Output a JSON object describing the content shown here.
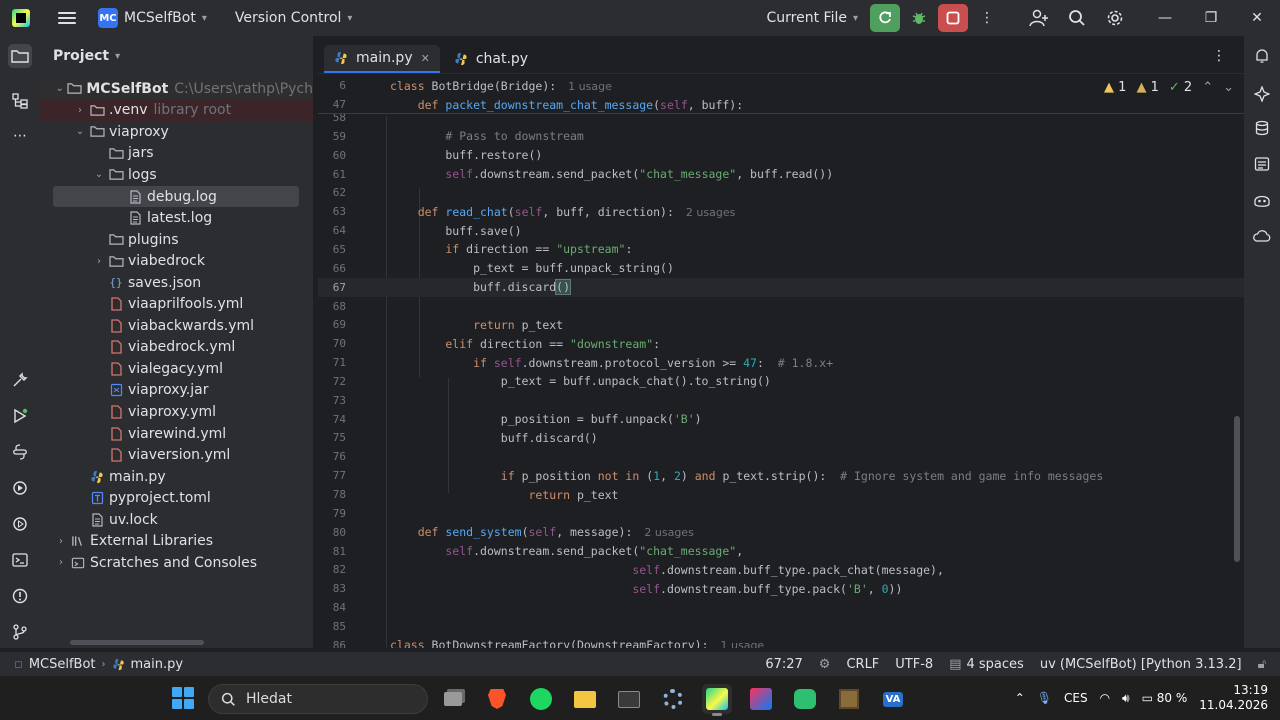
{
  "titlebar": {
    "project_badge": "MC",
    "project_name": "MCSelfBot",
    "vcs_label": "Version Control",
    "run_config": "Current File",
    "colors": {
      "run": "#4f9f5e",
      "stop": "#c94f4f"
    }
  },
  "project_panel": {
    "title": "Project",
    "tree": [
      {
        "label": "MCSelfBot",
        "hint": "C:\\Users\\rathp\\Pych",
        "icon": "folder-icon",
        "depth": 0,
        "arrow": "down",
        "bold": true
      },
      {
        "label": ".venv",
        "hint": "library root",
        "icon": "folder-icon",
        "depth": 1,
        "arrow": "right"
      },
      {
        "label": "viaproxy",
        "hint": "",
        "icon": "folder-icon",
        "depth": 1,
        "arrow": "down"
      },
      {
        "label": "jars",
        "hint": "",
        "icon": "folder-icon",
        "depth": 2,
        "arrow": ""
      },
      {
        "label": "logs",
        "hint": "",
        "icon": "folder-icon",
        "depth": 2,
        "arrow": "down"
      },
      {
        "label": "debug.log",
        "hint": "",
        "icon": "text-file-icon",
        "depth": 3,
        "arrow": "",
        "selected": true
      },
      {
        "label": "latest.log",
        "hint": "",
        "icon": "text-file-icon",
        "depth": 3,
        "arrow": ""
      },
      {
        "label": "plugins",
        "hint": "",
        "icon": "folder-icon",
        "depth": 2,
        "arrow": ""
      },
      {
        "label": "viabedrock",
        "hint": "",
        "icon": "folder-icon",
        "depth": 2,
        "arrow": "right"
      },
      {
        "label": "saves.json",
        "hint": "",
        "icon": "json-file-icon",
        "depth": 2,
        "arrow": ""
      },
      {
        "label": "viaaprilfools.yml",
        "hint": "",
        "icon": "yaml-file-icon",
        "depth": 2,
        "arrow": ""
      },
      {
        "label": "viabackwards.yml",
        "hint": "",
        "icon": "yaml-file-icon",
        "depth": 2,
        "arrow": ""
      },
      {
        "label": "viabedrock.yml",
        "hint": "",
        "icon": "yaml-file-icon",
        "depth": 2,
        "arrow": ""
      },
      {
        "label": "vialegacy.yml",
        "hint": "",
        "icon": "yaml-file-icon",
        "depth": 2,
        "arrow": ""
      },
      {
        "label": "viaproxy.jar",
        "hint": "",
        "icon": "jar-file-icon",
        "depth": 2,
        "arrow": ""
      },
      {
        "label": "viaproxy.yml",
        "hint": "",
        "icon": "yaml-file-icon",
        "depth": 2,
        "arrow": ""
      },
      {
        "label": "viarewind.yml",
        "hint": "",
        "icon": "yaml-file-icon",
        "depth": 2,
        "arrow": ""
      },
      {
        "label": "viaversion.yml",
        "hint": "",
        "icon": "yaml-file-icon",
        "depth": 2,
        "arrow": ""
      },
      {
        "label": "main.py",
        "hint": "",
        "icon": "python-file-icon",
        "depth": 1,
        "arrow": ""
      },
      {
        "label": "pyproject.toml",
        "hint": "",
        "icon": "toml-file-icon",
        "depth": 1,
        "arrow": ""
      },
      {
        "label": "uv.lock",
        "hint": "",
        "icon": "text-file-icon",
        "depth": 1,
        "arrow": ""
      },
      {
        "label": "External Libraries",
        "hint": "",
        "icon": "library-icon",
        "depth": 0,
        "arrow": "right"
      },
      {
        "label": "Scratches and Consoles",
        "hint": "",
        "icon": "scratches-icon",
        "depth": 0,
        "arrow": "right"
      }
    ]
  },
  "editor": {
    "tabs": [
      {
        "label": "main.py",
        "active": true
      },
      {
        "label": "chat.py",
        "active": false
      }
    ],
    "inspections": {
      "warnings": "1",
      "weak_warnings": "1",
      "typos": "2"
    },
    "sticky_lines": [
      {
        "num": "6",
        "tokens": [
          [
            "kw",
            "class "
          ],
          [
            "",
            "BotBridge(Bridge):"
          ]
        ],
        "usage": "1 usage"
      },
      {
        "num": "47",
        "tokens": [
          [
            "kw",
            "    def "
          ],
          [
            "fn",
            "packet_downstream_chat_message"
          ],
          [
            "",
            "("
          ],
          [
            "slf",
            "self"
          ],
          [
            "",
            ", buff):"
          ]
        ],
        "usage": ""
      }
    ],
    "lines": [
      {
        "num": "58",
        "tokens": []
      },
      {
        "num": "59",
        "tokens": [
          [
            "cmt",
            "        # Pass to downstream"
          ]
        ]
      },
      {
        "num": "60",
        "tokens": [
          [
            "",
            "        buff.restore()"
          ]
        ]
      },
      {
        "num": "61",
        "tokens": [
          [
            "slf",
            "        self"
          ],
          [
            "",
            ".downstream.send_packet("
          ],
          [
            "str",
            "\"chat_message\""
          ],
          [
            "",
            ", buff.read())"
          ]
        ]
      },
      {
        "num": "62",
        "tokens": []
      },
      {
        "num": "63",
        "tokens": [
          [
            "kw",
            "    def "
          ],
          [
            "fn",
            "read_chat"
          ],
          [
            "",
            "("
          ],
          [
            "slf",
            "self"
          ],
          [
            "",
            ", buff, direction):"
          ]
        ],
        "usage": "2 usages"
      },
      {
        "num": "64",
        "tokens": [
          [
            "",
            "        buff.save()"
          ]
        ]
      },
      {
        "num": "65",
        "tokens": [
          [
            "kw",
            "        if "
          ],
          [
            "",
            "direction == "
          ],
          [
            "str",
            "\"upstream\""
          ],
          [
            "",
            ":"
          ]
        ]
      },
      {
        "num": "66",
        "tokens": [
          [
            "",
            "            p_text = buff.unpack_string()"
          ]
        ]
      },
      {
        "num": "67",
        "tokens": [
          [
            "",
            "            buff.discard"
          ],
          [
            "brace",
            "()"
          ]
        ],
        "current": true
      },
      {
        "num": "68",
        "tokens": []
      },
      {
        "num": "69",
        "tokens": [
          [
            "kw",
            "            return "
          ],
          [
            "",
            "p_text"
          ]
        ]
      },
      {
        "num": "70",
        "tokens": [
          [
            "kw",
            "        elif "
          ],
          [
            "",
            "direction == "
          ],
          [
            "str",
            "\"downstream\""
          ],
          [
            "",
            ":"
          ]
        ]
      },
      {
        "num": "71",
        "tokens": [
          [
            "kw",
            "            if "
          ],
          [
            "slf",
            "self"
          ],
          [
            "",
            ".downstream.protocol_version >= "
          ],
          [
            "num",
            "47"
          ],
          [
            "",
            ":  "
          ],
          [
            "cmt",
            "# 1.8.x+"
          ]
        ]
      },
      {
        "num": "72",
        "tokens": [
          [
            "",
            "                p_text = buff.unpack_chat().to_string()"
          ]
        ]
      },
      {
        "num": "73",
        "tokens": []
      },
      {
        "num": "74",
        "tokens": [
          [
            "",
            "                p_position = buff.unpack("
          ],
          [
            "str",
            "'B'"
          ],
          [
            "",
            ")"
          ]
        ]
      },
      {
        "num": "75",
        "tokens": [
          [
            "",
            "                buff.discard()"
          ]
        ]
      },
      {
        "num": "76",
        "tokens": []
      },
      {
        "num": "77",
        "tokens": [
          [
            "kw",
            "                if "
          ],
          [
            "",
            "p_position "
          ],
          [
            "kw",
            "not in "
          ],
          [
            "",
            "("
          ],
          [
            "num",
            "1"
          ],
          [
            "",
            ", "
          ],
          [
            "num",
            "2"
          ],
          [
            "",
            ") "
          ],
          [
            "kw",
            "and "
          ],
          [
            "",
            "p_text.strip():  "
          ],
          [
            "cmt",
            "# Ignore system and game info messages"
          ]
        ]
      },
      {
        "num": "78",
        "tokens": [
          [
            "kw",
            "                    return "
          ],
          [
            "",
            "p_text"
          ]
        ]
      },
      {
        "num": "79",
        "tokens": []
      },
      {
        "num": "80",
        "tokens": [
          [
            "kw",
            "    def "
          ],
          [
            "fn",
            "send_system"
          ],
          [
            "",
            "("
          ],
          [
            "slf",
            "self"
          ],
          [
            "",
            ", message):"
          ]
        ],
        "usage": "2 usages"
      },
      {
        "num": "81",
        "tokens": [
          [
            "slf",
            "        self"
          ],
          [
            "",
            ".downstream.send_packet("
          ],
          [
            "str",
            "\"chat_message\""
          ],
          [
            "",
            ","
          ]
        ]
      },
      {
        "num": "82",
        "tokens": [
          [
            "slf",
            "                                   self"
          ],
          [
            "",
            ".downstream.buff_type.pack_chat(message),"
          ]
        ]
      },
      {
        "num": "83",
        "tokens": [
          [
            "slf",
            "                                   self"
          ],
          [
            "",
            ".downstream.buff_type.pack("
          ],
          [
            "str",
            "'B'"
          ],
          [
            "",
            ", "
          ],
          [
            "num",
            "0"
          ],
          [
            "",
            "))"
          ]
        ]
      },
      {
        "num": "84",
        "tokens": []
      },
      {
        "num": "85",
        "tokens": []
      },
      {
        "num": "86",
        "tokens": [
          [
            "kw",
            "class "
          ],
          [
            "",
            "BotDownstreamFactory(DownstreamFactory):"
          ]
        ],
        "usage": "1 usage"
      }
    ]
  },
  "statusbar": {
    "breadcrumb": [
      "MCSelfBot",
      "main.py"
    ],
    "position": "67:27",
    "line_sep": "CRLF",
    "encoding": "UTF-8",
    "indent": "4 spaces",
    "interpreter": "uv (MCSelfBot) [Python 3.13.2]"
  },
  "taskbar": {
    "search_placeholder": "Hledat",
    "language": "CES",
    "battery": "80 %",
    "time": "13:19",
    "date": "11.04.2026"
  }
}
